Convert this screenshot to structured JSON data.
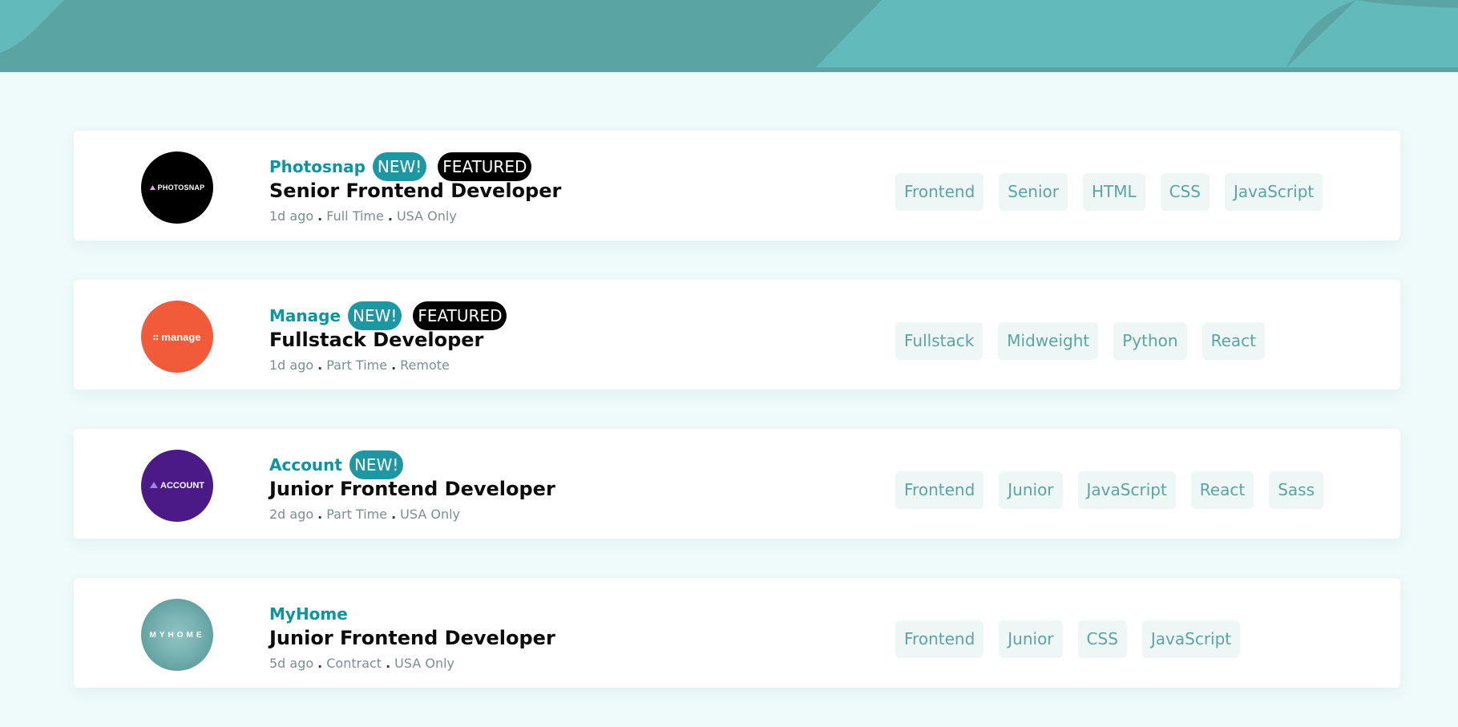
{
  "colors": {
    "header": "#5ba4a4",
    "background": "#effafa",
    "company_text": "#0c94a0",
    "badge_new": "#1d98a3",
    "badge_featured": "#000000",
    "tag_text": "#5ba4a4",
    "tag_bg": "#eef6f6"
  },
  "jobs": [
    {
      "logo_text": "PHOTOSNAP",
      "logo_color": "#000000",
      "company": "Photosnap",
      "new_label": "NEW!",
      "featured_label": "FEATURED",
      "position": "Senior Frontend Developer",
      "posted": "1d ago",
      "contract": "Full Time",
      "location": "USA Only",
      "tags": [
        "Frontend",
        "Senior",
        "HTML",
        "CSS",
        "JavaScript"
      ]
    },
    {
      "logo_text": "manage",
      "logo_color": "#f15b3a",
      "company": "Manage",
      "new_label": "NEW!",
      "featured_label": "FEATURED",
      "position": "Fullstack Developer",
      "posted": "1d ago",
      "contract": "Part Time",
      "location": "Remote",
      "tags": [
        "Fullstack",
        "Midweight",
        "Python",
        "React"
      ]
    },
    {
      "logo_text": "ACCOUNT",
      "logo_color": "#4b1a86",
      "company": "Account",
      "new_label": "NEW!",
      "position": "Junior Frontend Developer",
      "posted": "2d ago",
      "contract": "Part Time",
      "location": "USA Only",
      "tags": [
        "Frontend",
        "Junior",
        "JavaScript",
        "React",
        "Sass"
      ]
    },
    {
      "logo_text": "MYHOME",
      "logo_color": "#62a3a2",
      "company": "MyHome",
      "position": "Junior Frontend Developer",
      "posted": "5d ago",
      "contract": "Contract",
      "location": "USA Only",
      "tags": [
        "Frontend",
        "Junior",
        "CSS",
        "JavaScript"
      ]
    }
  ]
}
